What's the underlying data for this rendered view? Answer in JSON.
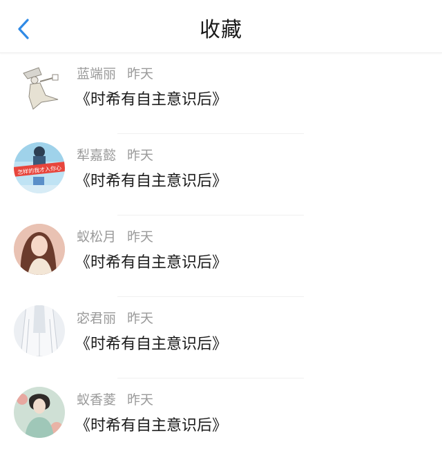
{
  "header": {
    "title": "收藏",
    "back_icon": "chevron-left-icon",
    "accent_color": "#2f8ae6"
  },
  "items": [
    {
      "name": "蓝端丽",
      "time": "昨天",
      "message": "《时希有自主意识后》",
      "avatar": "anime-character-avatar"
    },
    {
      "name": "犁嘉懿",
      "time": "昨天",
      "message": "《时希有自主意识后》",
      "avatar": "banner-text-avatar",
      "avatar_text": "怎样的我才入你心"
    },
    {
      "name": "蚁松月",
      "time": "昨天",
      "message": "《时希有自主意识后》",
      "avatar": "portrait-photo-avatar"
    },
    {
      "name": "宓君丽",
      "time": "昨天",
      "message": "《时希有自主意识后》",
      "avatar": "white-robe-avatar"
    },
    {
      "name": "蚁香菱",
      "time": "昨天",
      "message": "《时希有自主意识后》",
      "avatar": "painted-lady-avatar"
    }
  ]
}
